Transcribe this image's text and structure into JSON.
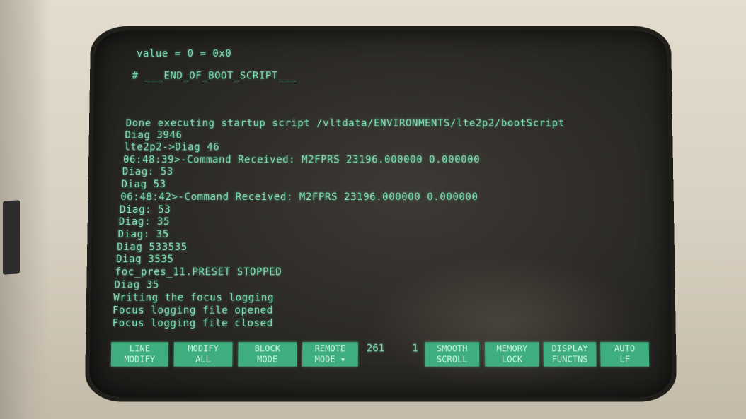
{
  "terminal": {
    "lines": [
      "value = 0 = 0x0",
      "# ___END_OF_BOOT_SCRIPT___",
      "Done executing startup script /vltdata/ENVIRONMENTS/lte2p2/bootScript",
      "Diag 3946",
      "lte2p2->Diag 46",
      "06:48:39>-Command Received: M2FPRS 23196.000000 0.000000",
      "Diag: 53",
      "Diag 53",
      "06:48:42>-Command Received: M2FPRS 23196.000000 0.000000",
      "Diag: 53",
      "Diag: 35",
      "Diag: 35",
      "Diag 533535",
      "Diag 3535",
      "foc_pres_11.PRESET STOPPED",
      "Diag 35",
      "Writing the focus logging",
      "Focus logging file opened",
      "Focus logging file closed"
    ]
  },
  "softkeys": [
    {
      "line1": "LINE",
      "line2": "MODIFY"
    },
    {
      "line1": "MODIFY",
      "line2": "ALL"
    },
    {
      "line1": "BLOCK",
      "line2": "MODE"
    },
    {
      "line1": "REMOTE",
      "line2": "MODE ▾"
    },
    {
      "line1": "SMOOTH",
      "line2": "SCROLL"
    },
    {
      "line1": "MEMORY",
      "line2": "LOCK"
    },
    {
      "line1": "DISPLAY",
      "line2": "FUNCTNS"
    },
    {
      "line1": "AUTO",
      "line2": "LF"
    }
  ],
  "status": {
    "row": "261",
    "col": "1"
  },
  "colors": {
    "phosphor": "#7ee2b6",
    "softkey_bg": "#3fae7f",
    "screen_bg": "#2b2925",
    "bezel": "#d7cfbf"
  }
}
